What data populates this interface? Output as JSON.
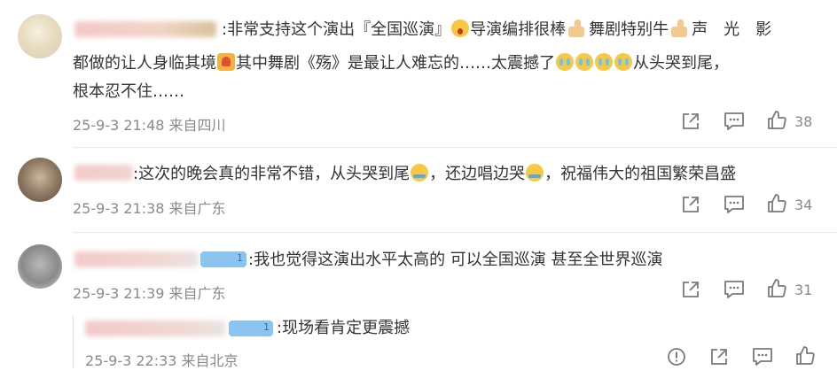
{
  "comments": [
    {
      "text_a": ":非常支持这个演出『全国巡演』",
      "text_b": "导演编排很棒",
      "text_c": "舞剧特别牛",
      "text_d": "声　光　影",
      "line2_a": "都做的让人身临其境",
      "line2_b": "其中舞剧《殇》是最让人难忘的……太震撼了",
      "line2_c": "从头哭到尾，",
      "line3": "根本忍不住……",
      "meta": "25-9-3 21:48 来自四川",
      "likes": "38"
    },
    {
      "text_a": ":这次的晚会真的非常不错，从头哭到尾",
      "text_b": "，还边唱边哭",
      "text_c": "，祝福伟大的祖国繁荣昌盛",
      "meta": "25-9-3 21:38 来自广东",
      "likes": "34"
    },
    {
      "text": ":我也觉得这演出水平太高的 可以全国巡演 甚至全世界巡演",
      "meta": "25-9-3 21:39 来自广东",
      "likes": "31",
      "badge": "1"
    }
  ],
  "reply": {
    "text": ":现场看肯定更震撼",
    "meta": "25-9-3 22:33 来自北京",
    "badge": "1"
  }
}
